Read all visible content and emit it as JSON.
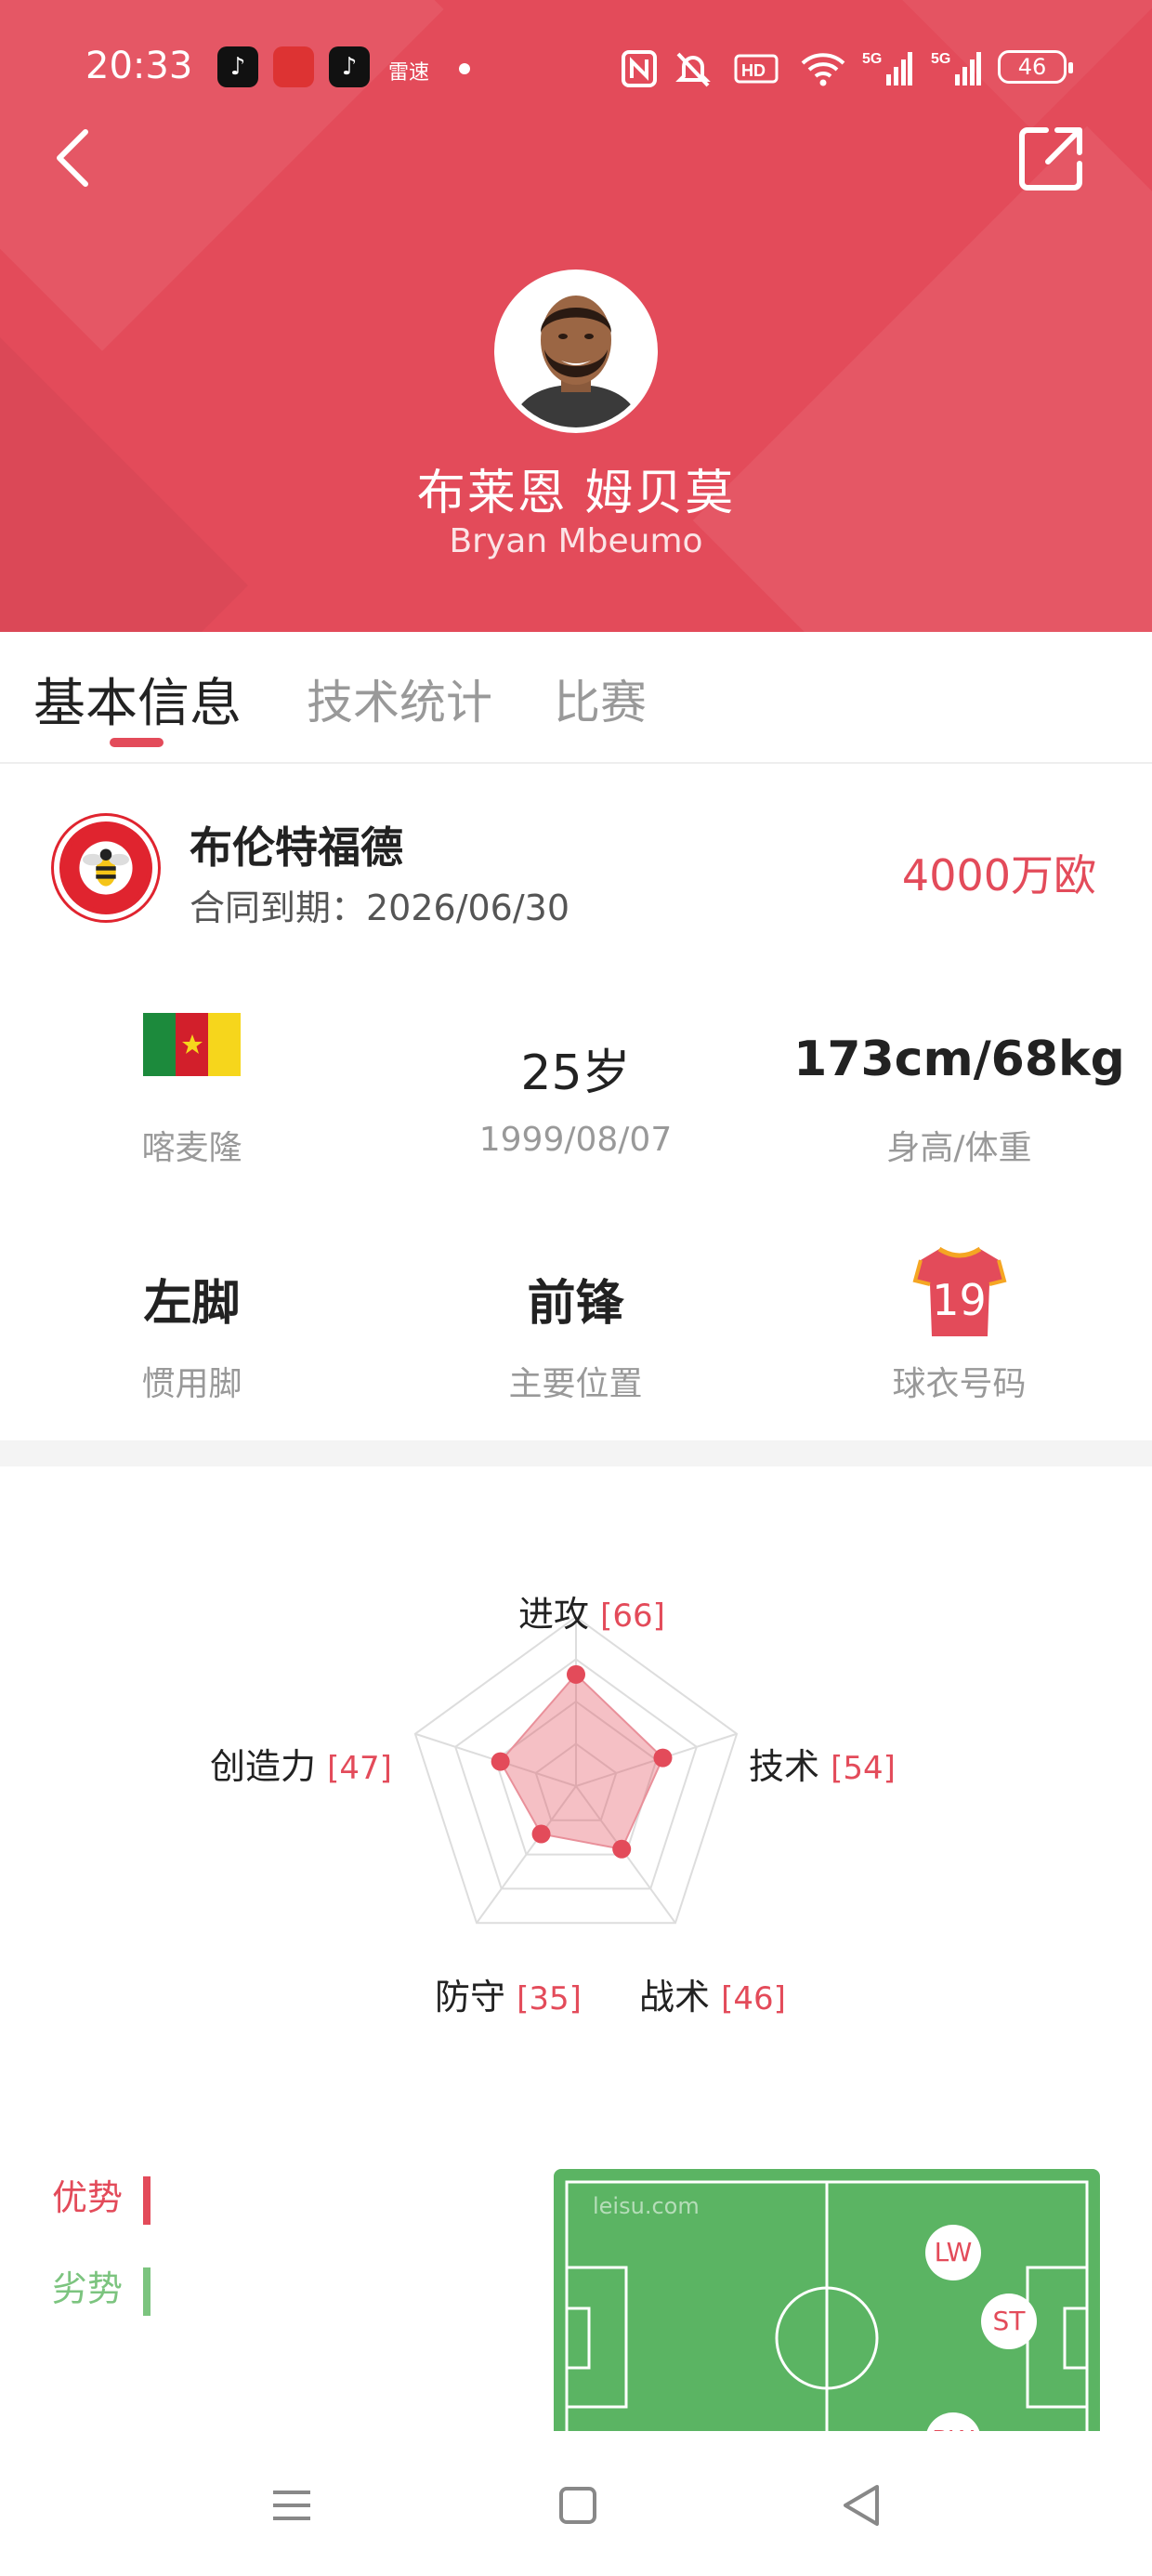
{
  "status_bar": {
    "time": "20:33",
    "app_icons": [
      "tiktok-icon",
      "aoke-icon",
      "tiktok-lite-icon"
    ],
    "notif_text": "雷速",
    "battery": "46"
  },
  "header": {
    "name_cn": "布莱恩 姆贝莫",
    "name_en": "Bryan Mbeumo",
    "back_icon": "chevron-left-icon",
    "share_icon": "share-icon"
  },
  "tabs": [
    {
      "label": "基本信息",
      "active": true
    },
    {
      "label": "技术统计",
      "active": false
    },
    {
      "label": "比赛",
      "active": false
    }
  ],
  "club": {
    "name": "布伦特福德",
    "contract": "合同到期：2026/06/30",
    "market_value": "4000万欧"
  },
  "info": {
    "nationality": "喀麦隆",
    "age": "25岁",
    "birthdate": "1999/08/07",
    "height_weight": "173cm/68kg",
    "height_weight_label": "身高/体重",
    "foot": "左脚",
    "foot_label": "惯用脚",
    "position": "前锋",
    "position_label": "主要位置",
    "shirt_number": "19",
    "shirt_label": "球衣号码"
  },
  "radar": {
    "attributes": [
      {
        "label": "进攻",
        "value": "[66]",
        "score": 66
      },
      {
        "label": "技术",
        "value": "[54]",
        "score": 54
      },
      {
        "label": "战术",
        "value": "[46]",
        "score": 46
      },
      {
        "label": "防守",
        "value": "[35]",
        "score": 35
      },
      {
        "label": "创造力",
        "value": "[47]",
        "score": 47
      }
    ]
  },
  "legend": {
    "strengths": "优势",
    "weaknesses": "劣势"
  },
  "field": {
    "watermark": "leisu.com",
    "positions": [
      "LW",
      "ST",
      "RW"
    ]
  },
  "colors": {
    "accent": "#e34b5a",
    "field_green": "#5bb463",
    "weakness_green": "#7cc47f"
  }
}
